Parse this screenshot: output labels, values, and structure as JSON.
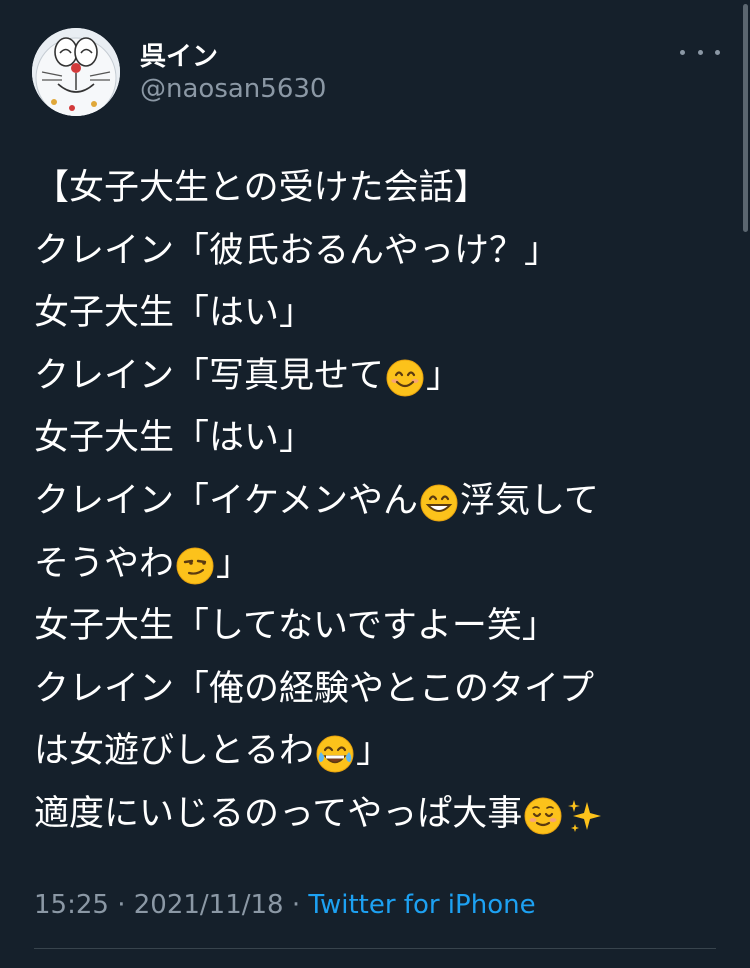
{
  "tweet": {
    "display_name": "呉イン",
    "handle": "@naosan5630",
    "lines": [
      [
        {
          "t": "【女子大生との受けた会話】"
        }
      ],
      [
        {
          "t": "クレイン「彼氏おるんやっけ？」"
        }
      ],
      [
        {
          "t": "女子大生「はい」"
        }
      ],
      [
        {
          "t": "クレイン「写真見せて"
        },
        {
          "e": "smiling-face-emoji"
        },
        {
          "t": "」"
        }
      ],
      [
        {
          "t": "女子大生「はい」"
        }
      ],
      [
        {
          "t": "クレイン「イケメンやん"
        },
        {
          "e": "grinning-face-emoji"
        },
        {
          "t": "浮気して"
        }
      ],
      [
        {
          "t": "そうやわ"
        },
        {
          "e": "smirking-face-emoji"
        },
        {
          "t": "」"
        }
      ],
      [
        {
          "t": "女子大生「してないですよー笑」"
        }
      ],
      [
        {
          "t": "クレイン「俺の経験やとこのタイプ"
        }
      ],
      [
        {
          "t": "は女遊びしとるわ"
        },
        {
          "e": "tears-of-joy-emoji"
        },
        {
          "t": "」"
        }
      ],
      [
        {
          "t": "適度にいじるのってやっぱ大事"
        },
        {
          "e": "relieved-face-emoji"
        },
        {
          "e": "sparkles-emoji"
        }
      ]
    ],
    "time": "15:25",
    "separator_1": " · ",
    "date": "2021/11/18",
    "separator_2": " · ",
    "source": "Twitter for iPhone"
  },
  "icons": {
    "avatar": "doraemon-avatar-icon",
    "more": "more-horizontal-icon"
  },
  "colors": {
    "background": "#15202b",
    "text": "#ffffff",
    "secondary": "#8b98a5",
    "link": "#1da1f2",
    "divider": "#38444d"
  }
}
